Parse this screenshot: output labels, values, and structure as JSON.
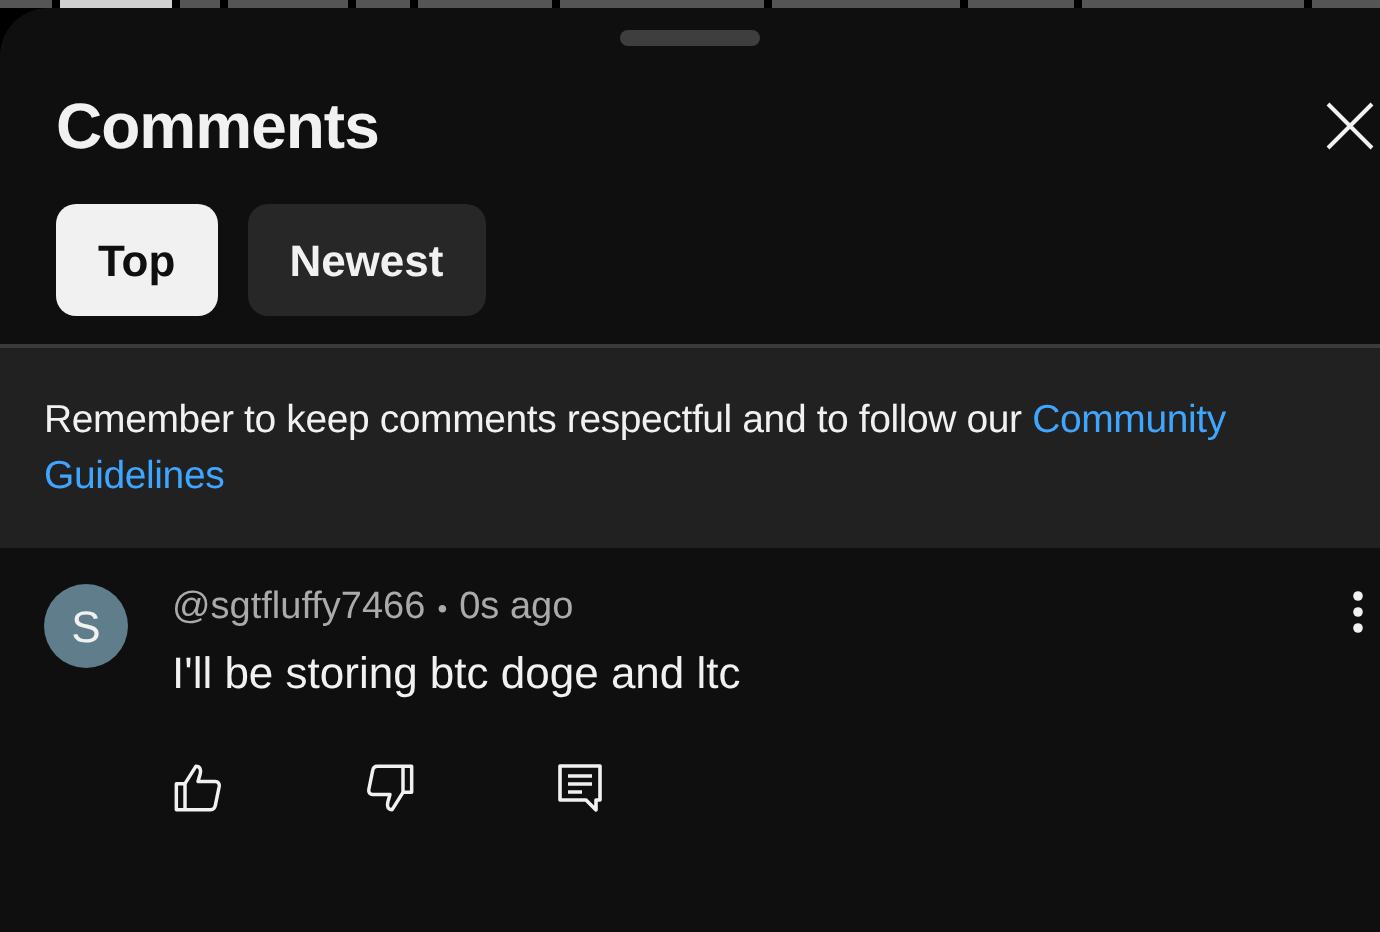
{
  "header": {
    "title": "Comments"
  },
  "filters": [
    {
      "label": "Top",
      "selected": true
    },
    {
      "label": "Newest",
      "selected": false
    }
  ],
  "notice": {
    "text": "Remember to keep comments respectful and to follow our ",
    "link_lines": [
      "Community",
      "Guidelines"
    ]
  },
  "comments": [
    {
      "avatar_initial": "S",
      "author": "@sgtfluffy7466",
      "separator": "•",
      "time": "0s ago",
      "text": "I'll be storing btc doge and ltc"
    }
  ]
}
